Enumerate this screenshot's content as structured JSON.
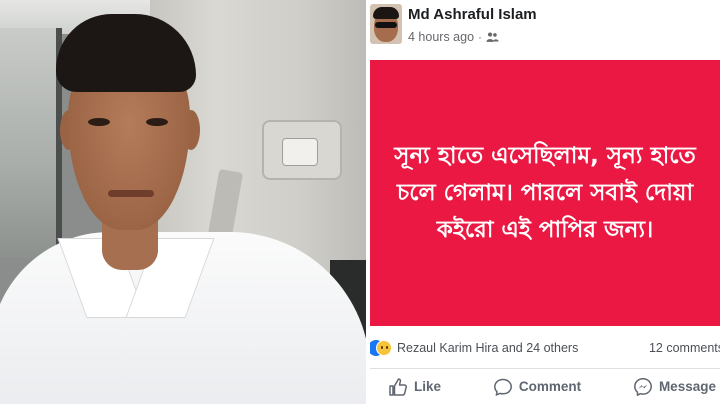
{
  "post": {
    "author": "Md Ashraful Islam",
    "timestamp": "4 hours ago",
    "separator": "·",
    "audience_icon": "friends-icon",
    "body_text": "সূন্য  হাতে এসেছিলাম, সূন্য হাতে চলে গেলাম। পারলে সবাই দোয়া কইরো এই পাপির জন্য।",
    "body_background": "#ea1842"
  },
  "reactions": {
    "summary": "Rezaul Karim Hira and 24 others",
    "icons": [
      "like-icon",
      "sad-icon"
    ],
    "comments": "12 comments"
  },
  "actions": {
    "like_label": "Like",
    "comment_label": "Comment",
    "message_label": "Message"
  },
  "colors": {
    "accent_blue": "#1877f2",
    "text_primary": "#1c1e21",
    "text_secondary": "#65676b"
  }
}
